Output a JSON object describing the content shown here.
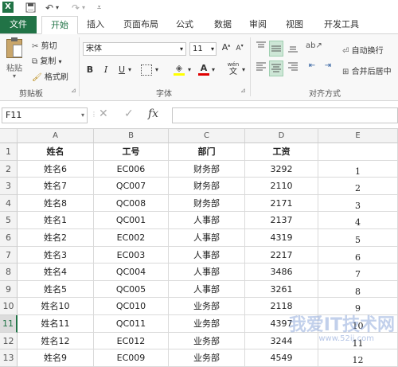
{
  "ribbon_tabs": [
    {
      "label": "文件",
      "kind": "file"
    },
    {
      "label": "开始",
      "kind": "active"
    },
    {
      "label": "插入",
      "kind": ""
    },
    {
      "label": "页面布局",
      "kind": ""
    },
    {
      "label": "公式",
      "kind": ""
    },
    {
      "label": "数据",
      "kind": ""
    },
    {
      "label": "审阅",
      "kind": ""
    },
    {
      "label": "视图",
      "kind": ""
    },
    {
      "label": "开发工具",
      "kind": ""
    }
  ],
  "clipboard": {
    "paste": "粘贴",
    "cut": "剪切",
    "copy": "复制",
    "format_painter": "格式刷",
    "group": "剪贴板"
  },
  "font": {
    "name": "宋体",
    "size": "11",
    "grow": "A",
    "shrink": "A",
    "bold": "B",
    "italic": "I",
    "underline": "U",
    "wen": "wén",
    "group": "字体"
  },
  "alignment": {
    "wrap": "自动换行",
    "merge": "合并后居中",
    "group": "对齐方式"
  },
  "formula_bar": {
    "name_box": "F11",
    "fx": "fx",
    "value": ""
  },
  "columns": [
    "A",
    "B",
    "C",
    "D",
    "E"
  ],
  "rows": [
    {
      "n": "1",
      "a": "姓名",
      "b": "工号",
      "c": "部门",
      "d": "工资",
      "e": ""
    },
    {
      "n": "2",
      "a": "姓名6",
      "b": "EC006",
      "c": "财务部",
      "d": "3292",
      "e": "1"
    },
    {
      "n": "3",
      "a": "姓名7",
      "b": "QC007",
      "c": "财务部",
      "d": "2110",
      "e": "2"
    },
    {
      "n": "4",
      "a": "姓名8",
      "b": "QC008",
      "c": "财务部",
      "d": "2171",
      "e": "3"
    },
    {
      "n": "5",
      "a": "姓名1",
      "b": "QC001",
      "c": "人事部",
      "d": "2137",
      "e": "4"
    },
    {
      "n": "6",
      "a": "姓名2",
      "b": "EC002",
      "c": "人事部",
      "d": "4319",
      "e": "5"
    },
    {
      "n": "7",
      "a": "姓名3",
      "b": "EC003",
      "c": "人事部",
      "d": "2217",
      "e": "6"
    },
    {
      "n": "8",
      "a": "姓名4",
      "b": "QC004",
      "c": "人事部",
      "d": "3486",
      "e": "7"
    },
    {
      "n": "9",
      "a": "姓名5",
      "b": "QC005",
      "c": "人事部",
      "d": "3261",
      "e": "8"
    },
    {
      "n": "10",
      "a": "姓名10",
      "b": "QC010",
      "c": "业务部",
      "d": "2118",
      "e": "9"
    },
    {
      "n": "11",
      "a": "姓名11",
      "b": "QC011",
      "c": "业务部",
      "d": "4397",
      "e": "10"
    },
    {
      "n": "12",
      "a": "姓名12",
      "b": "EC012",
      "c": "业务部",
      "d": "3244",
      "e": "11"
    },
    {
      "n": "13",
      "a": "姓名9",
      "b": "EC009",
      "c": "业务部",
      "d": "4549",
      "e": "12"
    }
  ],
  "active_row": "11",
  "watermark": {
    "main": "我爱IT技术网",
    "sub": "www.52ij.com"
  },
  "colors": {
    "accent": "#217346"
  }
}
